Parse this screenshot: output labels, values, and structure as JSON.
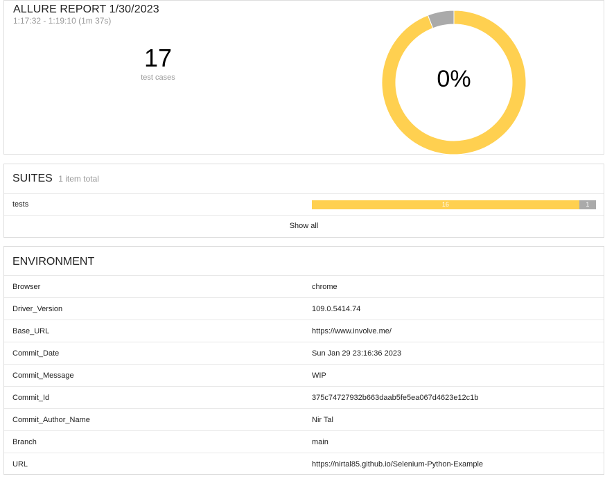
{
  "summary": {
    "title": "ALLURE REPORT 1/30/2023",
    "time_range": "1:17:32 - 1:19:10 (1m 37s)",
    "test_count": "17",
    "test_count_label": "test cases",
    "success_rate": "0%",
    "donut": {
      "segments": [
        {
          "status": "broken",
          "count": 16,
          "color": "#ffd050"
        },
        {
          "status": "skipped",
          "count": 1,
          "color": "#aaaaaa"
        }
      ]
    }
  },
  "suites": {
    "title": "SUITES",
    "subtitle": "1 item total",
    "items": [
      {
        "name": "tests",
        "bar": [
          {
            "status": "broken",
            "count": 16,
            "label": "16",
            "color": "#ffd050"
          },
          {
            "status": "skipped",
            "count": 1,
            "label": "1",
            "color": "#aaaaaa"
          }
        ]
      }
    ],
    "show_all_label": "Show all"
  },
  "environment": {
    "title": "ENVIRONMENT",
    "rows": [
      {
        "key": "Browser",
        "value": "chrome"
      },
      {
        "key": "Driver_Version",
        "value": "109.0.5414.74"
      },
      {
        "key": "Base_URL",
        "value": "https://www.involve.me/"
      },
      {
        "key": "Commit_Date",
        "value": "Sun Jan 29 23:16:36 2023"
      },
      {
        "key": "Commit_Message",
        "value": "WIP"
      },
      {
        "key": "Commit_Id",
        "value": "375c74727932b663daab5fe5ea067d4623e12c1b"
      },
      {
        "key": "Commit_Author_Name",
        "value": "Nir Tal"
      },
      {
        "key": "Branch",
        "value": "main"
      },
      {
        "key": "URL",
        "value": "https://nirtal85.github.io/Selenium-Python-Example"
      }
    ]
  }
}
